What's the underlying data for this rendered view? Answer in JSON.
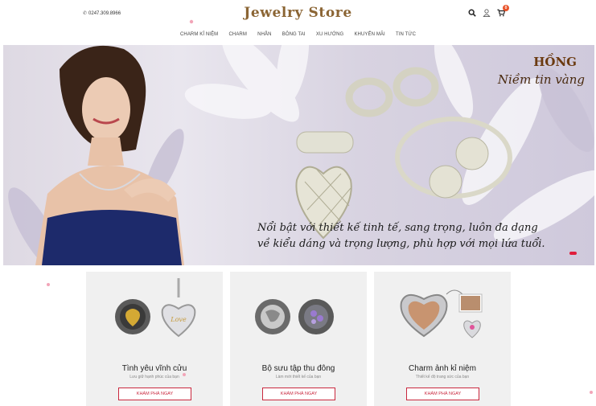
{
  "header": {
    "phone": "0247.309.8966",
    "logo": "Jewelry Store",
    "cart_count": "0",
    "icons": [
      "search-icon",
      "user-icon",
      "cart-icon"
    ]
  },
  "nav": [
    "CHARM KỈ NIỆM",
    "CHARM",
    "NHẪN",
    "BÔNG TAI",
    "XU HƯỚNG",
    "KHUYẾN MÃI",
    "TIN TỨC"
  ],
  "banner": {
    "brand": "HỒNG",
    "brand_sub": "Niềm tin vàng",
    "slogan_line1": "Nổi bật với thiết kế tinh tế, sang trọng, luôn đa dạng",
    "slogan_line2": "về kiểu dáng và trọng lượng, phù hợp với mọi lứa tuổi."
  },
  "cards": [
    {
      "title": "Tình yêu vĩnh cửu",
      "desc": "Lưu giữ hạnh phúc của bạn",
      "button": "KHÁM PHÁ NGAY"
    },
    {
      "title": "Bộ sưu tập thu đông",
      "desc": "Làm mới thiết kế của bạn",
      "button": "KHÁM PHÁ NGAY"
    },
    {
      "title": "Charm ảnh kỉ niệm",
      "desc": "Thiết kế độ trang sức của bạn",
      "button": "KHÁM PHÁ NGAY"
    }
  ],
  "colors": {
    "logo": "#8b6534",
    "accent": "#c9283e",
    "badge": "#e8532a",
    "banner_bg": "#ded9e3",
    "card_bg": "#f0f0f0"
  }
}
